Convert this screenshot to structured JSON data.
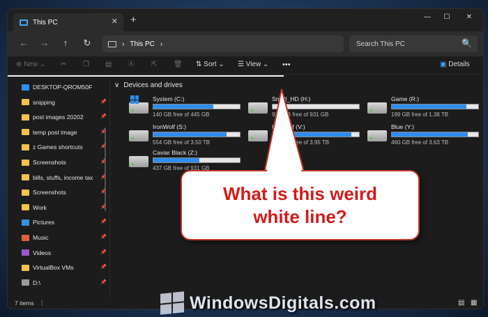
{
  "tab": {
    "title": "This PC",
    "close": "✕",
    "new_tab": "+"
  },
  "window_controls": {
    "minimize": "—",
    "maximize": "☐",
    "close": "✕"
  },
  "nav": {
    "back": "←",
    "forward": "→",
    "up": "↑",
    "refresh": "↻"
  },
  "address": {
    "icon": "monitor-icon",
    "sep": "›",
    "location": "This PC",
    "sep2": "›"
  },
  "search": {
    "placeholder": "Search This PC",
    "icon": "🔍"
  },
  "toolbar": {
    "new_label": "New",
    "sort_label": "Sort",
    "view_label": "View",
    "more": "•••",
    "details_label": "Details"
  },
  "sidebar": {
    "items": [
      {
        "label": "DESKTOP-QROM50F",
        "icon": "computer-icon",
        "color": "#2f8ded"
      },
      {
        "label": "snipping",
        "icon": "folder-icon",
        "color": "#f2c14e"
      },
      {
        "label": "post images 20202",
        "icon": "folder-icon",
        "color": "#f2c14e"
      },
      {
        "label": "temp post image",
        "icon": "folder-icon",
        "color": "#f2c14e"
      },
      {
        "label": "z Games shortcuts",
        "icon": "folder-icon",
        "color": "#f2c14e"
      },
      {
        "label": "Screenshots",
        "icon": "folder-icon",
        "color": "#f2c14e"
      },
      {
        "label": "bills, stuffs, income tax",
        "icon": "folder-icon",
        "color": "#f2c14e"
      },
      {
        "label": "Screenshots",
        "icon": "folder-icon",
        "color": "#f2c14e"
      },
      {
        "label": "Work",
        "icon": "folder-icon",
        "color": "#f2c14e"
      },
      {
        "label": "Pictures",
        "icon": "pictures-icon",
        "color": "#3b8fe0"
      },
      {
        "label": "Music",
        "icon": "music-icon",
        "color": "#e0603b"
      },
      {
        "label": "Videos",
        "icon": "videos-icon",
        "color": "#9b59d0"
      },
      {
        "label": "VirtualBox VMs",
        "icon": "folder-icon",
        "color": "#f2c14e"
      },
      {
        "label": "D:\\",
        "icon": "drive-icon",
        "color": "#9a9a9a"
      }
    ],
    "pin": "📌"
  },
  "main": {
    "section_chevron": "∨",
    "section_title": "Devices and drives",
    "drives": [
      {
        "name": "System (C:)",
        "free": "140 GB free of 445 GB",
        "used_pct": 0.69
      },
      {
        "name": "Small_HD (H:)",
        "free": "931 GB free of 931 GB",
        "used_pct": 0.0
      },
      {
        "name": "Game (R:)",
        "free": "199 GB free of 1.38 TB",
        "used_pct": 0.86
      },
      {
        "name": "IronWolf (S:)",
        "free": "554 GB free of 3.50 TB",
        "used_pct": 0.85
      },
      {
        "name": "IronWolf (V:)",
        "free": "364 GB free of 3.95 TB",
        "used_pct": 0.91
      },
      {
        "name": "Blue (Y:)",
        "free": "460 GB free of 3.63 TB",
        "used_pct": 0.88
      },
      {
        "name": "Caviar Black (Z:)",
        "free": "437 GB free of 931 GB",
        "used_pct": 0.53
      }
    ]
  },
  "status": {
    "count": "7 items",
    "sep": "|"
  },
  "callout": {
    "line1": "What is this weird",
    "line2": "white line?"
  },
  "watermark": {
    "text": "WindowsDigitals.com"
  }
}
